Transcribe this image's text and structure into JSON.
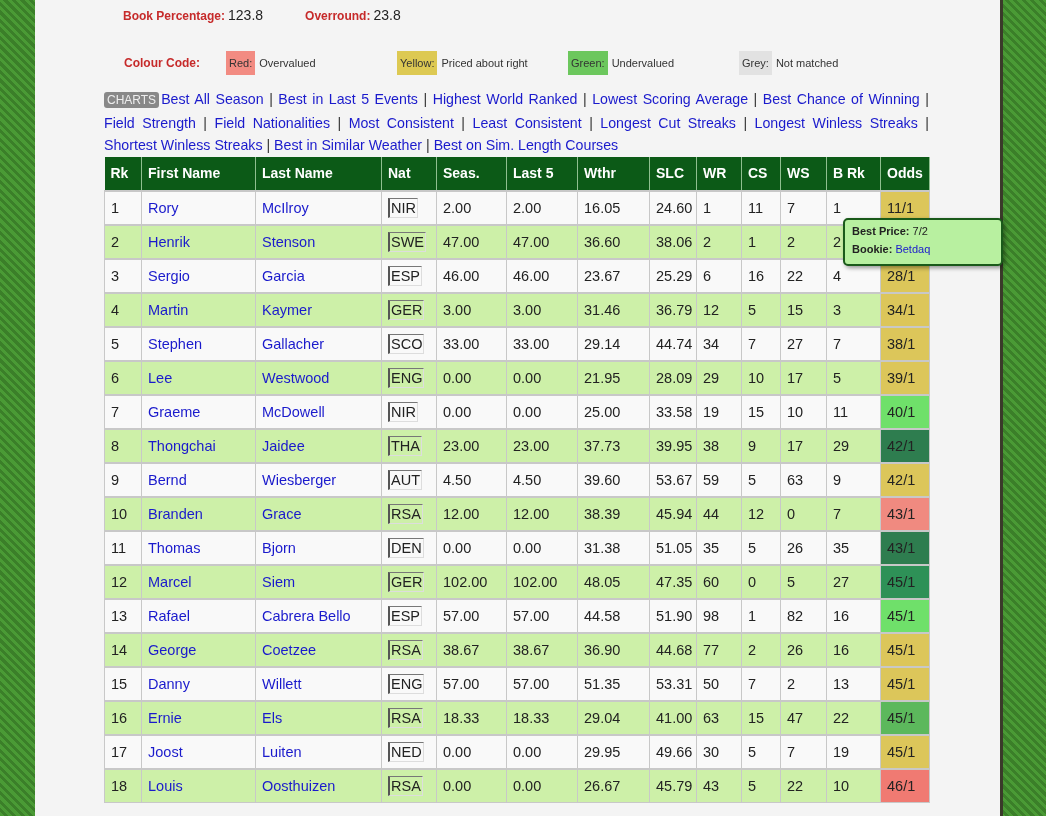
{
  "stats": [
    {
      "label": "Book Percentage:",
      "value": "123.8"
    },
    {
      "label": "Overround:",
      "value": "23.8"
    }
  ],
  "colour_code": {
    "label": "Colour Code:",
    "items": [
      {
        "swatch": "Red:",
        "text": "Overvalued",
        "color": "#f28b82"
      },
      {
        "swatch": "Yellow:",
        "text": "Priced about right",
        "color": "#ddc953"
      },
      {
        "swatch": "Green:",
        "text": "Undervalued",
        "color": "#6cc75d"
      },
      {
        "swatch": "Grey:",
        "text": "Not matched",
        "color": "#e2e2e2"
      }
    ]
  },
  "charts": {
    "badge": "CHARTS",
    "links": [
      "Best All Season",
      "Best in Last 5 Events",
      "Highest World Ranked",
      "Lowest Scoring Average",
      "Best Chance of Winning",
      "Field Strength",
      "Field Nationalities",
      "Most Consistent",
      "Least Consistent",
      "Longest Cut Streaks",
      "Longest Winless Streaks",
      "Shortest Winless Streaks",
      "Best in Similar Weather",
      "Best on Sim. Length Courses"
    ],
    "separator": "|"
  },
  "table": {
    "columns": [
      "Rk",
      "First Name",
      "Last Name",
      "Nat",
      "Seas.",
      "Last 5",
      "Wthr",
      "SLC",
      "WR",
      "CS",
      "WS",
      "B Rk",
      "Odds"
    ],
    "rows": [
      {
        "cells": [
          "1",
          "Rory",
          "McIlroy",
          "NIR",
          "2.00",
          "2.00",
          "16.05",
          "24.60",
          "1",
          "11",
          "7",
          "1",
          "11/1"
        ],
        "color": "#dcc65a"
      },
      {
        "cells": [
          "2",
          "Henrik",
          "Stenson",
          "SWE",
          "47.00",
          "47.00",
          "36.60",
          "38.06",
          "2",
          "1",
          "2",
          "2"
        ]
      },
      {
        "cells": [
          "3",
          "Sergio",
          "Garcia",
          "ESP",
          "46.00",
          "46.00",
          "23.67",
          "25.29",
          "6",
          "16",
          "22",
          "4",
          "28/1"
        ],
        "color": "#dcc65a"
      },
      {
        "cells": [
          "4",
          "Martin",
          "Kaymer",
          "GER",
          "3.00",
          "3.00",
          "31.46",
          "36.79",
          "12",
          "5",
          "15",
          "3",
          "34/1"
        ],
        "color": "#dcc65a"
      },
      {
        "cells": [
          "5",
          "Stephen",
          "Gallacher",
          "SCO",
          "33.00",
          "33.00",
          "29.14",
          "44.74",
          "34",
          "7",
          "27",
          "7",
          "38/1"
        ],
        "color": "#dcc65a"
      },
      {
        "cells": [
          "6",
          "Lee",
          "Westwood",
          "ENG",
          "0.00",
          "0.00",
          "21.95",
          "28.09",
          "29",
          "10",
          "17",
          "5",
          "39/1"
        ],
        "color": "#dcc65a"
      },
      {
        "cells": [
          "7",
          "Graeme",
          "McDowell",
          "NIR",
          "0.00",
          "0.00",
          "25.00",
          "33.58",
          "19",
          "15",
          "10",
          "11",
          "40/1"
        ],
        "color": "#6fe06a"
      },
      {
        "cells": [
          "8",
          "Thongchai",
          "Jaidee",
          "THA",
          "23.00",
          "23.00",
          "37.73",
          "39.95",
          "38",
          "9",
          "17",
          "29",
          "42/1"
        ],
        "color": "#2e7d4f"
      },
      {
        "cells": [
          "9",
          "Bernd",
          "Wiesberger",
          "AUT",
          "4.50",
          "4.50",
          "39.60",
          "53.67",
          "59",
          "5",
          "63",
          "9",
          "42/1"
        ],
        "color": "#dcc65a"
      },
      {
        "cells": [
          "10",
          "Branden",
          "Grace",
          "RSA",
          "12.00",
          "12.00",
          "38.39",
          "45.94",
          "44",
          "12",
          "0",
          "7",
          "43/1"
        ],
        "color": "#f08a80"
      },
      {
        "cells": [
          "11",
          "Thomas",
          "Bjorn",
          "DEN",
          "0.00",
          "0.00",
          "31.38",
          "51.05",
          "35",
          "5",
          "26",
          "35",
          "43/1"
        ],
        "color": "#2e7d4f"
      },
      {
        "cells": [
          "12",
          "Marcel",
          "Siem",
          "GER",
          "102.00",
          "102.00",
          "48.05",
          "47.35",
          "60",
          "0",
          "5",
          "27",
          "45/1"
        ],
        "color": "#2e9157"
      },
      {
        "cells": [
          "13",
          "Rafael",
          "Cabrera Bello",
          "ESP",
          "57.00",
          "57.00",
          "44.58",
          "51.90",
          "98",
          "1",
          "82",
          "16",
          "45/1"
        ],
        "color": "#6fe06a"
      },
      {
        "cells": [
          "14",
          "George",
          "Coetzee",
          "RSA",
          "38.67",
          "38.67",
          "36.90",
          "44.68",
          "77",
          "2",
          "26",
          "16",
          "45/1"
        ],
        "color": "#dcc65a"
      },
      {
        "cells": [
          "15",
          "Danny",
          "Willett",
          "ENG",
          "57.00",
          "57.00",
          "51.35",
          "53.31",
          "50",
          "7",
          "2",
          "13",
          "45/1"
        ],
        "color": "#dcc65a"
      },
      {
        "cells": [
          "16",
          "Ernie",
          "Els",
          "RSA",
          "18.33",
          "18.33",
          "29.04",
          "41.00",
          "63",
          "15",
          "47",
          "22",
          "45/1"
        ],
        "color": "#5cb85c"
      },
      {
        "cells": [
          "17",
          "Joost",
          "Luiten",
          "NED",
          "0.00",
          "0.00",
          "29.95",
          "49.66",
          "30",
          "5",
          "7",
          "19",
          "45/1"
        ],
        "color": "#dcc65a"
      },
      {
        "cells": [
          "18",
          "Louis",
          "Oosthuizen",
          "RSA",
          "0.00",
          "0.00",
          "26.67",
          "45.79",
          "43",
          "5",
          "22",
          "10",
          "46/1"
        ],
        "color": "#f07a72"
      }
    ]
  },
  "tooltip": {
    "lines": [
      {
        "label": "Best Price:",
        "value": "7/2",
        "kind": "text"
      },
      {
        "label": "Bookie:",
        "value": "Betdaq",
        "kind": "link"
      }
    ]
  }
}
